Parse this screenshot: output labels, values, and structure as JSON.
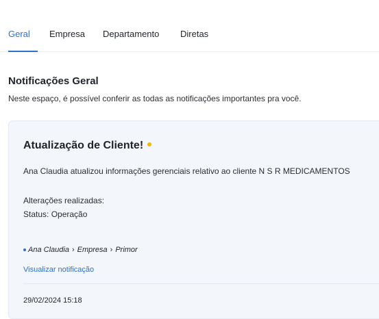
{
  "tabs": [
    {
      "label": "Geral",
      "active": true
    },
    {
      "label": "Empresa",
      "active": false
    },
    {
      "label": "Departamento",
      "active": false
    },
    {
      "label": "Diretas",
      "active": false
    }
  ],
  "section": {
    "title": "Notificações Geral",
    "description": "Neste espaço, é possível conferir as todas as notificações importantes pra você."
  },
  "notification": {
    "title": "Atualização de Cliente!",
    "unread_dot_color": "#f5b800",
    "body": "Ana Claudia atualizou informações gerenciais relativo ao cliente N S R MEDICAMENTOS",
    "changes_label": "Alterações realizadas:",
    "status_line": "Status: Operação",
    "breadcrumb": [
      "Ana Claudia",
      "Empresa",
      "Primor"
    ],
    "view_link": "Visualizar notificação",
    "date": "29/02/2024 15:18"
  },
  "colors": {
    "accent": "#2f6fce",
    "card_background": "#f3f6fa"
  }
}
